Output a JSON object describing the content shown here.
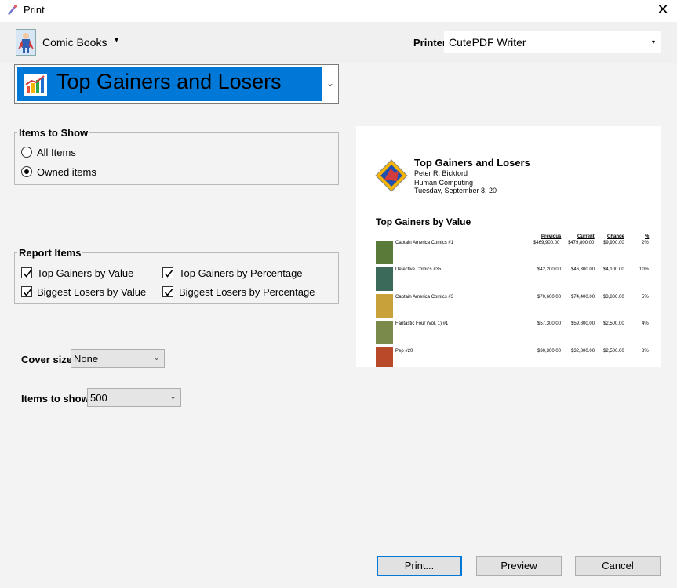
{
  "window": {
    "title": "Print",
    "close_glyph": "✕"
  },
  "database": {
    "name": "Comic Books",
    "caret": "▾"
  },
  "printer": {
    "label": "Printer",
    "value": "CutePDF Writer",
    "caret": "▾"
  },
  "report": {
    "selected": "Top Gainers and Losers",
    "caret": "⌄"
  },
  "items_to_show_group": {
    "title": "Items to Show",
    "options": [
      {
        "label": "All Items",
        "selected": false
      },
      {
        "label": "Owned items",
        "selected": true
      }
    ]
  },
  "report_items_group": {
    "title": "Report Items",
    "items": [
      {
        "label": "Top Gainers by Value",
        "checked": true
      },
      {
        "label": "Top Gainers by Percentage",
        "checked": true
      },
      {
        "label": "Biggest Losers by Value",
        "checked": true
      },
      {
        "label": "Biggest Losers by Percentage",
        "checked": true
      }
    ]
  },
  "cover_size": {
    "label": "Cover size",
    "value": "None"
  },
  "items_count": {
    "label": "Items to show",
    "value": "500"
  },
  "preview": {
    "title": "Top Gainers and Losers",
    "author": "Peter R. Bickford",
    "company": "Human Computing",
    "date": "Tuesday, September 8, 20",
    "section": "Top Gainers by Value",
    "columns": [
      "Previous",
      "Current",
      "Change",
      "%"
    ],
    "rows": [
      {
        "title": "Captain America Comics #1",
        "previous": "$469,900.00",
        "current": "$479,800.00",
        "change": "$9,900.00",
        "pct": "2%"
      },
      {
        "title": "Detective Comics #35",
        "previous": "$42,200.00",
        "current": "$46,300.00",
        "change": "$4,100.00",
        "pct": "10%"
      },
      {
        "title": "Captain America Comics #3",
        "previous": "$70,600.00",
        "current": "$74,400.00",
        "change": "$3,800.00",
        "pct": "5%"
      },
      {
        "title": "Fantastic Four (Vol. 1) #1",
        "previous": "$57,300.00",
        "current": "$59,800.00",
        "change": "$2,500.00",
        "pct": "4%"
      },
      {
        "title": "Pep #20",
        "previous": "$30,300.00",
        "current": "$32,800.00",
        "change": "$2,500.00",
        "pct": "8%"
      }
    ]
  },
  "buttons": {
    "print": "Print...",
    "preview": "Preview",
    "cancel": "Cancel"
  },
  "colors": {
    "accent": "#0078d7",
    "window_bg": "#f3f3f3"
  },
  "icons": [
    "app-icon",
    "superhero-database-icon",
    "chart-icon",
    "close-icon",
    "comic-cover-thumbnail"
  ]
}
